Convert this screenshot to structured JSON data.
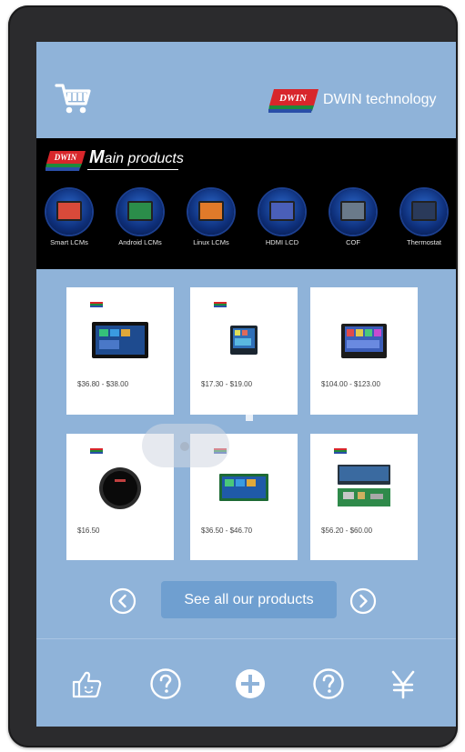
{
  "header": {
    "logo_text": "DWIN",
    "brand_name": "DWIN technology",
    "cart_icon": "shopping-cart-icon"
  },
  "banner": {
    "logo_text": "DWIN",
    "title_initial": "M",
    "title_rest": "ain products",
    "categories": [
      {
        "label": "Smart LCMs",
        "color": "#d84a3a"
      },
      {
        "label": "Android LCMs",
        "color": "#2b8d4a"
      },
      {
        "label": "Linux LCMs",
        "color": "#e07a2a"
      },
      {
        "label": "HDMI LCD",
        "color": "#4a5fb8"
      },
      {
        "label": "COF",
        "color": "#6a7a8a"
      },
      {
        "label": "Thermostat",
        "color": "#2a3a5a"
      }
    ]
  },
  "products": [
    {
      "price": "$36.80 - $38.00",
      "image": "black-display-panel"
    },
    {
      "price": "$17.30 - $19.00",
      "image": "small-square-display"
    },
    {
      "price": "$104.00 - $123.00",
      "image": "framed-display"
    },
    {
      "price": "$16.50",
      "image": "round-display"
    },
    {
      "price": "$36.50 - $46.70",
      "image": "green-board-display"
    },
    {
      "price": "$56.20 - $60.00",
      "image": "wide-display-module"
    }
  ],
  "pager": {
    "see_all_label": "See all our products",
    "prev_icon": "chevron-left-circle-icon",
    "next_icon": "chevron-right-circle-icon"
  },
  "bottom_nav": {
    "items": [
      {
        "icon": "thumbs-up-icon"
      },
      {
        "icon": "question-circle-icon"
      },
      {
        "icon": "plus-circle-icon"
      },
      {
        "icon": "question-circle-icon"
      },
      {
        "icon": "yen-icon"
      }
    ]
  },
  "colors": {
    "screen_bg": "#8fb3d9",
    "button_bg": "#6f9fd0",
    "banner_bg": "#000000"
  }
}
